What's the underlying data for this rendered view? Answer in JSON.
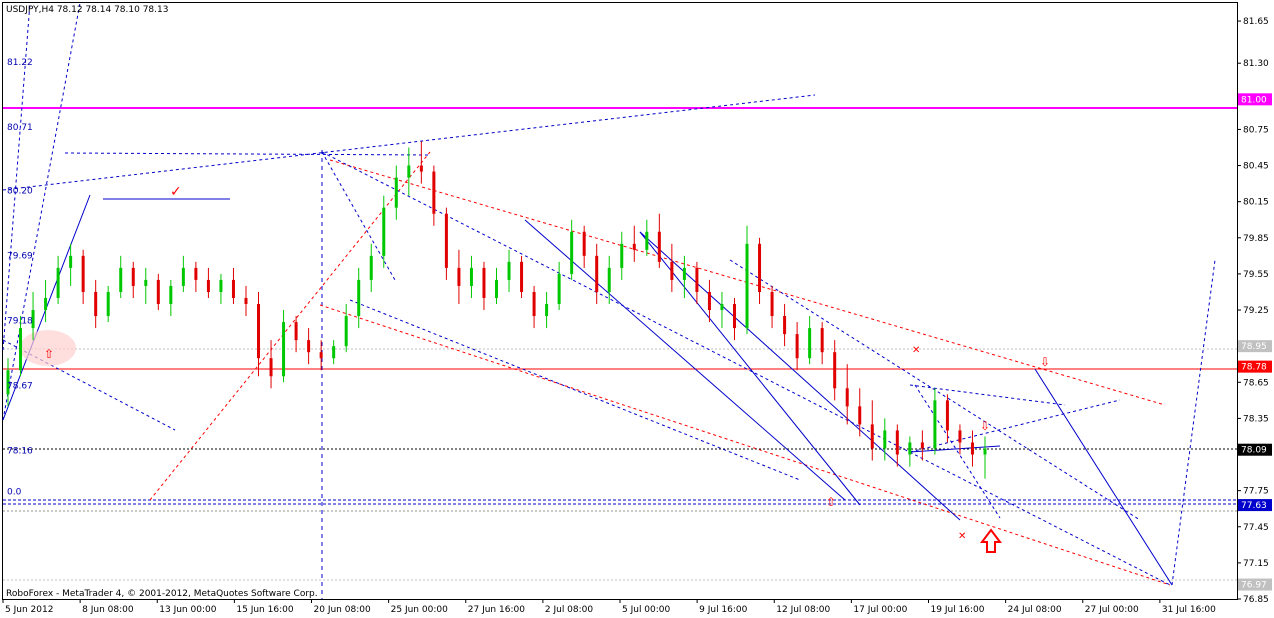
{
  "header": {
    "symbol_line": "USDJPY,H4  78.12 78.14 78.10 78.13"
  },
  "footer": {
    "copyright": "RoboForex - MetaTrader 4, © 2001-2012, MetaQuotes Software Corp."
  },
  "colors": {
    "bull": "#00c800",
    "bear": "#e00000",
    "axis": "#000000",
    "magenta_line": "#ff00ff",
    "red_line": "#ff0000",
    "blue": "#0000cc",
    "label_blue_bg": "#0000cc",
    "label_grey_bg": "#c0c0c0"
  },
  "chart_data": {
    "type": "candlestick",
    "price_axis": {
      "min": 76.85,
      "max": 81.8,
      "ticks": [
        "81.65",
        "81.30",
        "80.75",
        "80.45",
        "80.15",
        "79.85",
        "79.55",
        "79.25",
        "78.65",
        "78.35",
        "77.75",
        "77.45",
        "77.15",
        "76.85"
      ]
    },
    "time_axis": {
      "labels": [
        "5 Jun 2012",
        "8 Jun 08:00",
        "13 Jun 00:00",
        "15 Jun 16:00",
        "20 Jun 08:00",
        "25 Jun 00:00",
        "27 Jun 16:00",
        "2 Jul 08:00",
        "5 Jul 00:00",
        "9 Jul 16:00",
        "12 Jul 08:00",
        "17 Jul 00:00",
        "19 Jul 16:00",
        "24 Jul 08:00",
        "27 Jul 00:00",
        "31 Jul 16:00"
      ]
    },
    "price_labels": [
      {
        "text": "81.00",
        "price": 81.0,
        "style": "magenta"
      },
      {
        "text": "78.95",
        "price": 78.95,
        "style": "grey"
      },
      {
        "text": "78.78",
        "price": 78.78,
        "style": "red"
      },
      {
        "text": "78.09",
        "price": 78.09,
        "style": "dark"
      },
      {
        "text": "77.63",
        "price": 77.63,
        "style": "blue"
      },
      {
        "text": "76.97",
        "price": 76.97,
        "style": "grey"
      }
    ],
    "fibo_labels": [
      {
        "text": "81.22",
        "price": 81.27
      },
      {
        "text": "80.71",
        "price": 80.73
      },
      {
        "text": "80.20",
        "price": 80.2
      },
      {
        "text": "79.69",
        "price": 79.66
      },
      {
        "text": "79.18",
        "price": 79.12
      },
      {
        "text": "78.67",
        "price": 78.58
      },
      {
        "text": "78.16",
        "price": 78.04
      },
      {
        "text": "0.0",
        "price": 77.7
      }
    ],
    "candles": [
      [
        78.55,
        78.85,
        78.45,
        78.75
      ],
      [
        78.75,
        79.2,
        78.7,
        79.1
      ],
      [
        79.1,
        79.4,
        79.0,
        79.25
      ],
      [
        79.25,
        79.5,
        79.15,
        79.35
      ],
      [
        79.35,
        79.7,
        79.3,
        79.6
      ],
      [
        79.6,
        79.8,
        79.45,
        79.7
      ],
      [
        79.7,
        79.75,
        79.3,
        79.4
      ],
      [
        79.4,
        79.5,
        79.1,
        79.2
      ],
      [
        79.2,
        79.45,
        79.15,
        79.4
      ],
      [
        79.4,
        79.7,
        79.35,
        79.6
      ],
      [
        79.6,
        79.65,
        79.35,
        79.45
      ],
      [
        79.45,
        79.6,
        79.3,
        79.5
      ],
      [
        79.5,
        79.55,
        79.25,
        79.3
      ],
      [
        79.3,
        79.5,
        79.2,
        79.45
      ],
      [
        79.45,
        79.7,
        79.4,
        79.6
      ],
      [
        79.6,
        79.65,
        79.4,
        79.5
      ],
      [
        79.5,
        79.6,
        79.35,
        79.4
      ],
      [
        79.4,
        79.55,
        79.3,
        79.5
      ],
      [
        79.5,
        79.6,
        79.3,
        79.35
      ],
      [
        79.35,
        79.45,
        79.2,
        79.3
      ],
      [
        79.3,
        79.4,
        78.7,
        78.85
      ],
      [
        78.85,
        79.0,
        78.6,
        78.7
      ],
      [
        78.7,
        79.25,
        78.65,
        79.15
      ],
      [
        79.15,
        79.2,
        78.9,
        79.0
      ],
      [
        79.0,
        79.1,
        78.8,
        78.9
      ],
      [
        78.9,
        79.0,
        78.75,
        78.85
      ],
      [
        78.85,
        79.0,
        78.8,
        78.95
      ],
      [
        78.95,
        79.3,
        78.9,
        79.2
      ],
      [
        79.2,
        79.6,
        79.1,
        79.5
      ],
      [
        79.5,
        79.8,
        79.4,
        79.7
      ],
      [
        79.7,
        80.2,
        79.6,
        80.1
      ],
      [
        80.1,
        80.45,
        80.0,
        80.35
      ],
      [
        80.35,
        80.6,
        80.2,
        80.45
      ],
      [
        80.45,
        80.65,
        80.3,
        80.4
      ],
      [
        80.4,
        80.45,
        79.95,
        80.05
      ],
      [
        80.05,
        80.1,
        79.5,
        79.6
      ],
      [
        79.6,
        79.75,
        79.3,
        79.45
      ],
      [
        79.45,
        79.7,
        79.35,
        79.6
      ],
      [
        79.6,
        79.65,
        79.25,
        79.35
      ],
      [
        79.35,
        79.6,
        79.3,
        79.5
      ],
      [
        79.5,
        79.75,
        79.4,
        79.65
      ],
      [
        79.65,
        79.7,
        79.35,
        79.4
      ],
      [
        79.4,
        79.45,
        79.1,
        79.2
      ],
      [
        79.2,
        79.4,
        79.1,
        79.3
      ],
      [
        79.3,
        79.65,
        79.25,
        79.55
      ],
      [
        79.55,
        80.0,
        79.5,
        79.9
      ],
      [
        79.9,
        79.95,
        79.6,
        79.7
      ],
      [
        79.7,
        79.8,
        79.3,
        79.4
      ],
      [
        79.4,
        79.7,
        79.3,
        79.6
      ],
      [
        79.6,
        79.9,
        79.5,
        79.8
      ],
      [
        79.8,
        79.95,
        79.65,
        79.75
      ],
      [
        79.75,
        80.0,
        79.7,
        79.9
      ],
      [
        79.9,
        80.05,
        79.6,
        79.65
      ],
      [
        79.65,
        79.8,
        79.4,
        79.5
      ],
      [
        79.5,
        79.7,
        79.35,
        79.6
      ],
      [
        79.6,
        79.65,
        79.3,
        79.4
      ],
      [
        79.4,
        79.5,
        79.15,
        79.25
      ],
      [
        79.25,
        79.4,
        79.1,
        79.3
      ],
      [
        79.3,
        79.35,
        79.0,
        79.1
      ],
      [
        79.1,
        79.95,
        79.05,
        79.8
      ],
      [
        79.8,
        79.85,
        79.3,
        79.4
      ],
      [
        79.4,
        79.45,
        79.1,
        79.2
      ],
      [
        79.2,
        79.3,
        78.95,
        79.05
      ],
      [
        79.05,
        79.15,
        78.75,
        78.85
      ],
      [
        78.85,
        79.2,
        78.8,
        79.1
      ],
      [
        79.1,
        79.15,
        78.8,
        78.9
      ],
      [
        78.9,
        79.0,
        78.5,
        78.6
      ],
      [
        78.6,
        78.8,
        78.3,
        78.45
      ],
      [
        78.45,
        78.6,
        78.2,
        78.3
      ],
      [
        78.3,
        78.5,
        78.0,
        78.1
      ],
      [
        78.1,
        78.35,
        78.0,
        78.25
      ],
      [
        78.25,
        78.3,
        77.95,
        78.05
      ],
      [
        78.05,
        78.2,
        77.95,
        78.15
      ],
      [
        78.15,
        78.25,
        78.0,
        78.1
      ],
      [
        78.1,
        78.6,
        78.05,
        78.5
      ],
      [
        78.5,
        78.55,
        78.15,
        78.25
      ],
      [
        78.25,
        78.3,
        78.05,
        78.15
      ],
      [
        78.15,
        78.25,
        77.95,
        78.05
      ],
      [
        78.05,
        78.2,
        77.85,
        78.1
      ]
    ]
  }
}
